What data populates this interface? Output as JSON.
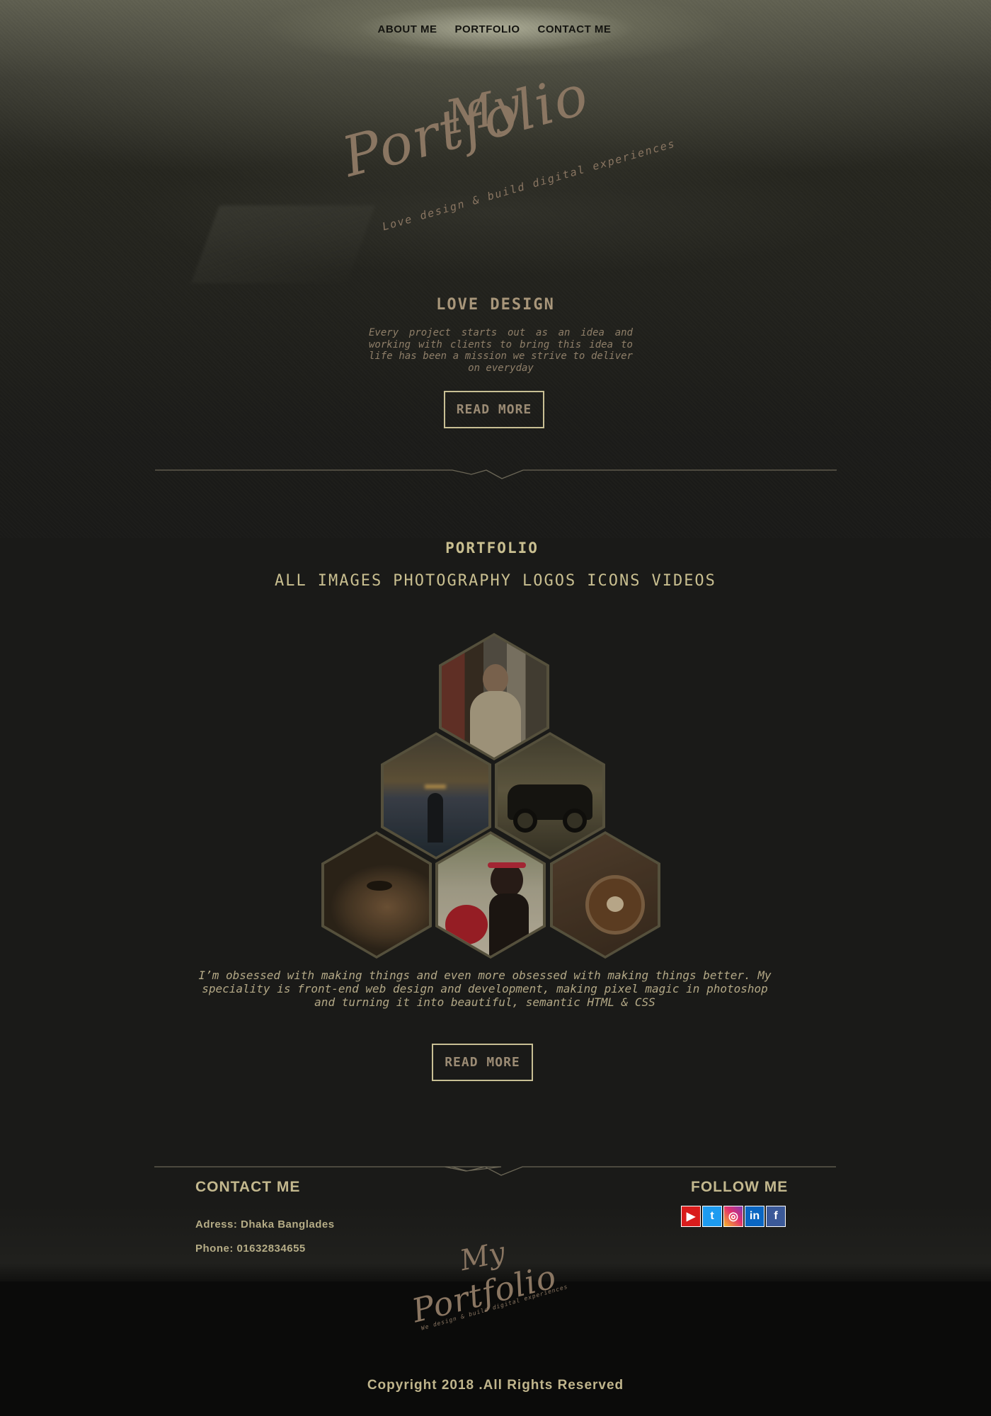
{
  "nav": {
    "items": [
      "ABOUT ME",
      "PORTFOLIO",
      "CONTACT ME"
    ]
  },
  "logo": {
    "line1": "My",
    "line2": "Portfolio",
    "tagline": "Love design & build digital experiences"
  },
  "hero": {
    "heading": "LOVE DESIGN",
    "text": "Every project starts out as an idea and working with clients to bring this idea to life has been a mission we strive to deliver on everyday",
    "button": "READ MORE"
  },
  "portfolio": {
    "title": "PORTFOLIO",
    "filters": [
      "ALL",
      "IMAGES",
      "PHOTOGRAPHY",
      "LOGOS",
      "ICONS",
      "VIDEOS"
    ],
    "text": "I’m obsessed with making things and even more obsessed with making things better. My speciality is front-end web design and development, making pixel magic in photoshop and turning it into beautiful, semantic HTML & CSS",
    "button": "READ MORE"
  },
  "footer": {
    "contact_heading": "CONTACT ME",
    "address": "Adress: Dhaka Banglades",
    "phone": "Phone: 01632834655",
    "follow_heading": "FOLLOW ME",
    "social": [
      "youtube-icon",
      "twitter-icon",
      "instagram-icon",
      "linkedin-icon",
      "facebook-icon"
    ],
    "logo_line1": "My",
    "logo_line2": "Portfolio",
    "logo_tagline": "We design & build digital experiences",
    "copyright": "Copyright 2018 .All Rights Reserved"
  },
  "colors": {
    "accent": "#c9bf90",
    "logo": "#8a7662",
    "background": "#1a1a18"
  }
}
